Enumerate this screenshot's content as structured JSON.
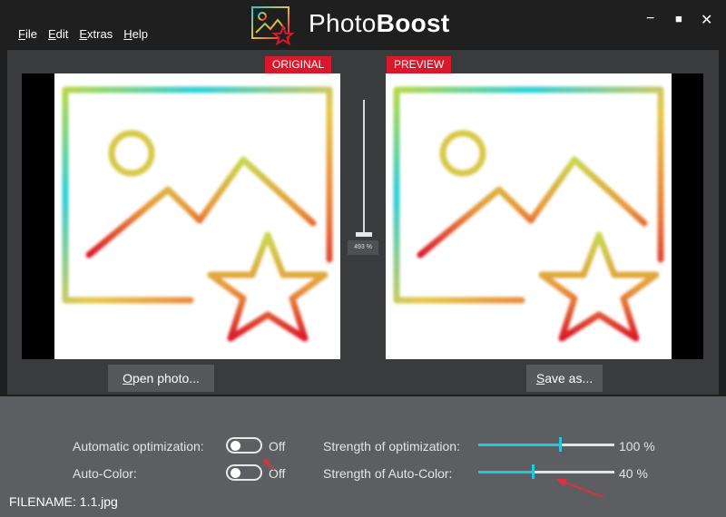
{
  "menu": {
    "items": [
      "File",
      "Edit",
      "Extras",
      "Help"
    ]
  },
  "title": {
    "part1": "Photo",
    "part2": "Boost"
  },
  "window": {
    "minimize": "−",
    "maximize": "■",
    "close": "✕"
  },
  "labels": {
    "original": "ORIGINAL",
    "preview": "PREVIEW"
  },
  "buttons": {
    "open": "Open photo...",
    "save": "Save as..."
  },
  "zoom": {
    "label": "493 %"
  },
  "settings": {
    "auto_opt_label": "Automatic optimization:",
    "auto_opt_state": "Off",
    "auto_color_label": "Auto-Color:",
    "auto_color_state": "Off",
    "strength_opt_label": "Strength of optimization:",
    "strength_opt_value": "100 %",
    "strength_opt_level": 0.6,
    "strength_color_label": "Strength of Auto-Color:",
    "strength_color_value": "40 %",
    "strength_color_level": 0.4
  },
  "file": {
    "label": "FILENAME: 1.1.jpg"
  },
  "colors": {
    "accent": "#21c8dc",
    "tag_red": "#d9192b",
    "annotation_red": "#e0303a"
  },
  "icons": [
    "photoboost-logo-icon",
    "image-star-icon",
    "arrow-annotation-icon"
  ]
}
